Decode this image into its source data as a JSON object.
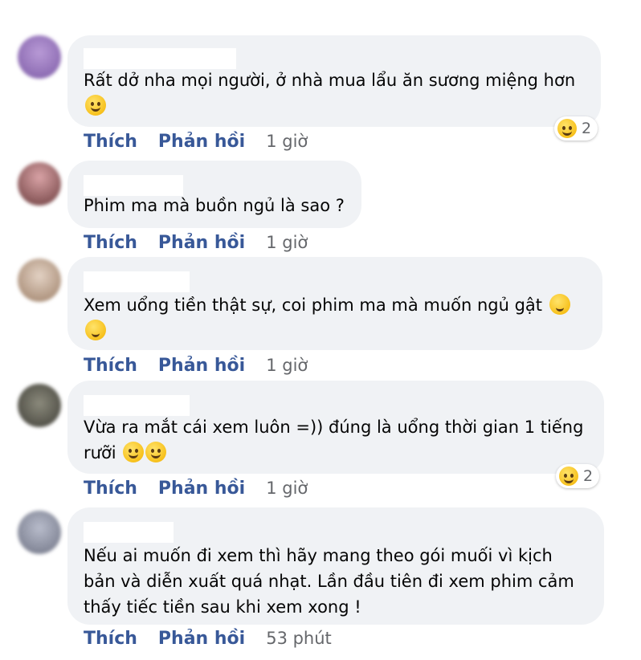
{
  "comments": [
    {
      "text": "Rất dở nha mọi người, ở nhà mua lẩu ăn sương miệng hơn",
      "emoji": "face-with-tear-icon",
      "reaction_count": "2",
      "like": "Thích",
      "reply": "Phản hồi",
      "time": "1 giờ"
    },
    {
      "text": "Phim ma mà buồn ngủ là sao ?",
      "like": "Thích",
      "reply": "Phản hồi",
      "time": "1 giờ"
    },
    {
      "text": "Xem uổng tiền thật sự, coi phim ma mà muốn ngủ gật",
      "emoji": "sleeping-face-icon",
      "like": "Thích",
      "reply": "Phản hồi",
      "time": "1 giờ"
    },
    {
      "text": "Vừa ra mắt cái xem luôn =)) đúng là uổng thời gian 1 tiếng rưỡi",
      "emoji": "grinning-face-icon",
      "reaction_count": "2",
      "like": "Thích",
      "reply": "Phản hồi",
      "time": "1 giờ"
    },
    {
      "text": "Nếu ai muốn đi xem thì hãy mang theo gói muối vì kịch bản và diễn xuất quá nhạt. Lần đầu tiên đi xem phim cảm thấy tiếc tiền sau khi xem xong !",
      "like": "Thích",
      "reply": "Phản hồi",
      "time": "53 phút"
    }
  ],
  "colors": {
    "bubble": "#f0f2f5",
    "action": "#385898",
    "meta": "#65676b"
  }
}
